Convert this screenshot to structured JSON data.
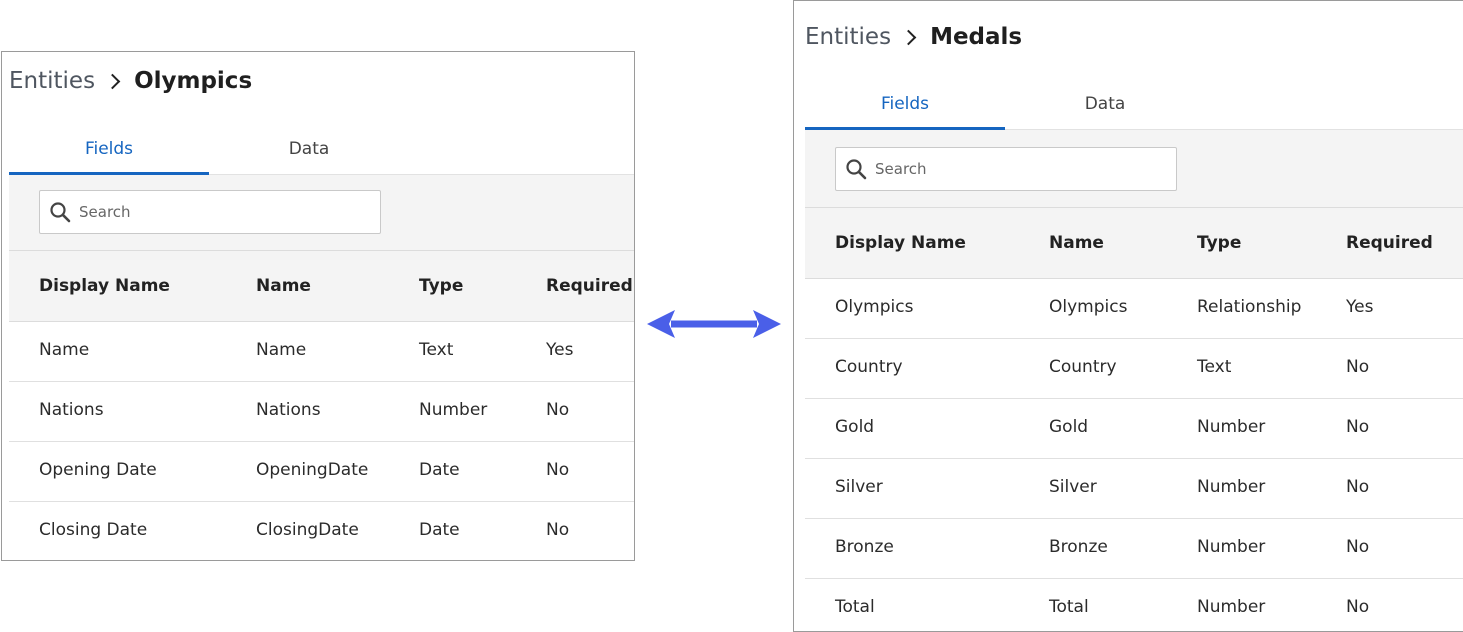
{
  "left_panel": {
    "breadcrumb": {
      "root": "Entities",
      "current": "Olympics"
    },
    "tabs": [
      {
        "label": "Fields",
        "active": true
      },
      {
        "label": "Data",
        "active": false
      }
    ],
    "search": {
      "placeholder": "Search",
      "value": ""
    },
    "columns": [
      "Display Name",
      "Name",
      "Type",
      "Required"
    ],
    "rows": [
      [
        "Name",
        "Name",
        "Text",
        "Yes"
      ],
      [
        "Nations",
        "Nations",
        "Number",
        "No"
      ],
      [
        "Opening Date",
        "OpeningDate",
        "Date",
        "No"
      ],
      [
        "Closing Date",
        "ClosingDate",
        "Date",
        "No"
      ]
    ]
  },
  "right_panel": {
    "breadcrumb": {
      "root": "Entities",
      "current": "Medals"
    },
    "tabs": [
      {
        "label": "Fields",
        "active": true
      },
      {
        "label": "Data",
        "active": false
      }
    ],
    "search": {
      "placeholder": "Search",
      "value": ""
    },
    "columns": [
      "Display Name",
      "Name",
      "Type",
      "Required"
    ],
    "rows": [
      [
        "Olympics",
        "Olympics",
        "Relationship",
        "Yes"
      ],
      [
        "Country",
        "Country",
        "Text",
        "No"
      ],
      [
        "Gold",
        "Gold",
        "Number",
        "No"
      ],
      [
        "Silver",
        "Silver",
        "Number",
        "No"
      ],
      [
        "Bronze",
        "Bronze",
        "Number",
        "No"
      ],
      [
        "Total",
        "Total",
        "Number",
        "No"
      ]
    ]
  },
  "connector": {
    "icon": "double-arrow-icon",
    "color": "#4a5fe8"
  },
  "theme": {
    "accent": "#1565c0"
  }
}
